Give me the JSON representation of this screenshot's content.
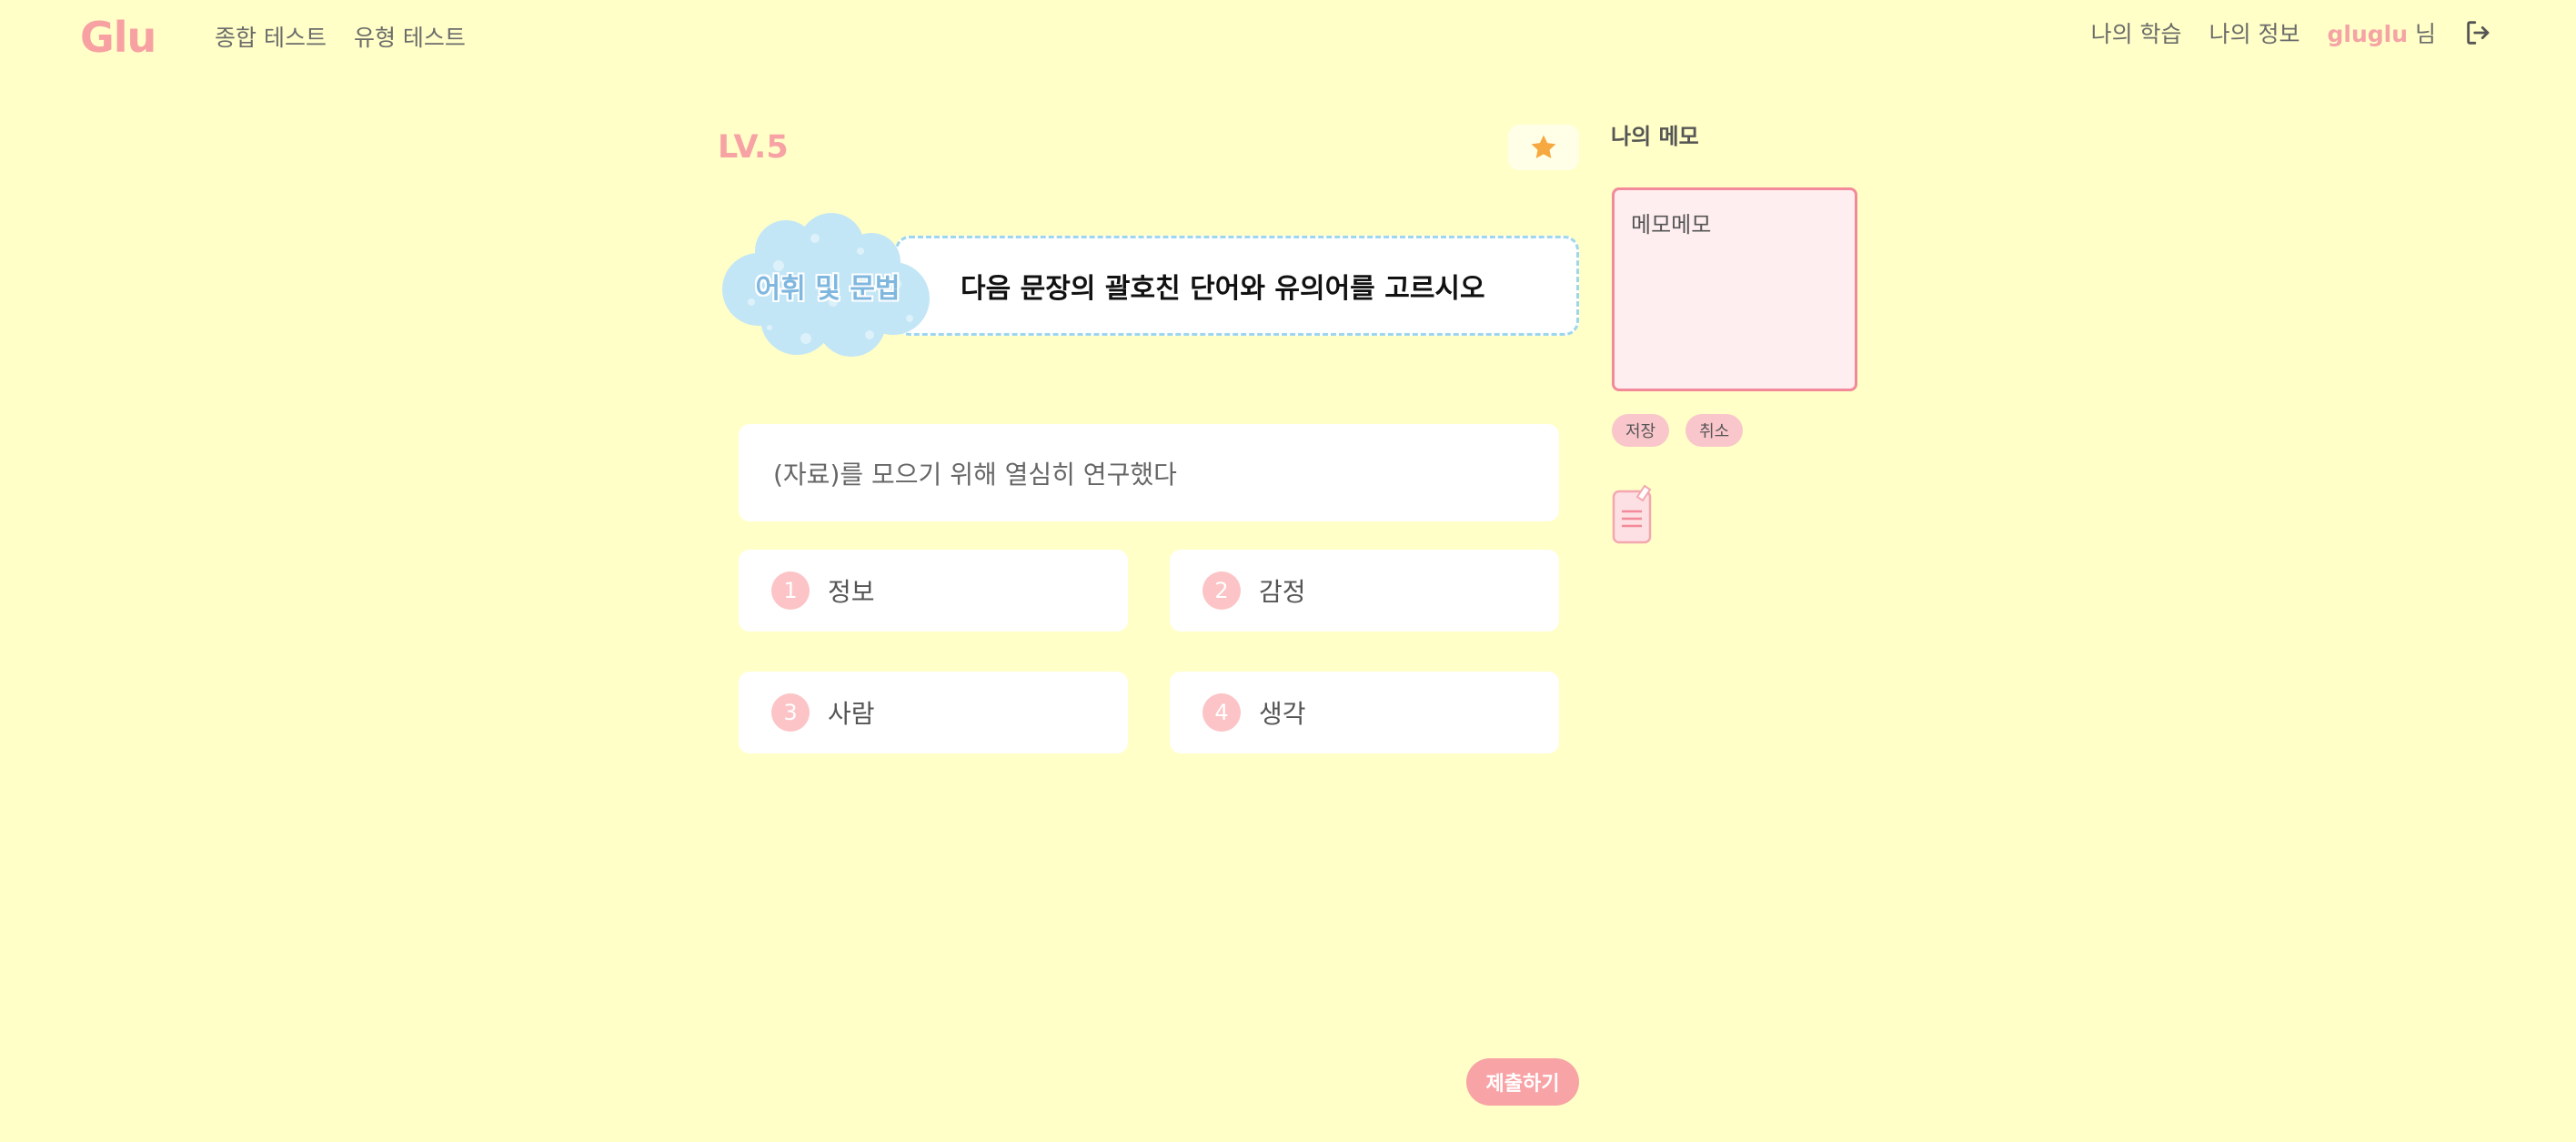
{
  "header": {
    "logo": "Glu",
    "nav": [
      "종합 테스트",
      "유형 테스트"
    ],
    "my_study": "나의 학습",
    "my_info": "나의 정보",
    "username": "gluglu",
    "user_suffix": " 님",
    "logout_icon": "logout-icon"
  },
  "quiz": {
    "level": "LV.5",
    "favorite_icon": "star-icon",
    "category": "어휘 및 문법",
    "question": "다음 문장의 괄호친 단어와 유의어를 고르시오",
    "sentence": "(자료)를 모으기 위해 열심히 연구했다",
    "options": [
      {
        "num": "1",
        "text": "정보"
      },
      {
        "num": "2",
        "text": "감정"
      },
      {
        "num": "3",
        "text": "사람"
      },
      {
        "num": "4",
        "text": "생각"
      }
    ],
    "submit_label": "제출하기"
  },
  "memo": {
    "title": "나의 메모",
    "value": "메모메모",
    "save_label": "저장",
    "cancel_label": "취소",
    "memo_icon": "memo-pad-icon"
  },
  "colors": {
    "background": "#ffffc7",
    "accent_pink": "#f7a1a3",
    "cloud_blue": "#bfe4f5",
    "memo_border": "#f28a99",
    "star": "#f6a940"
  }
}
